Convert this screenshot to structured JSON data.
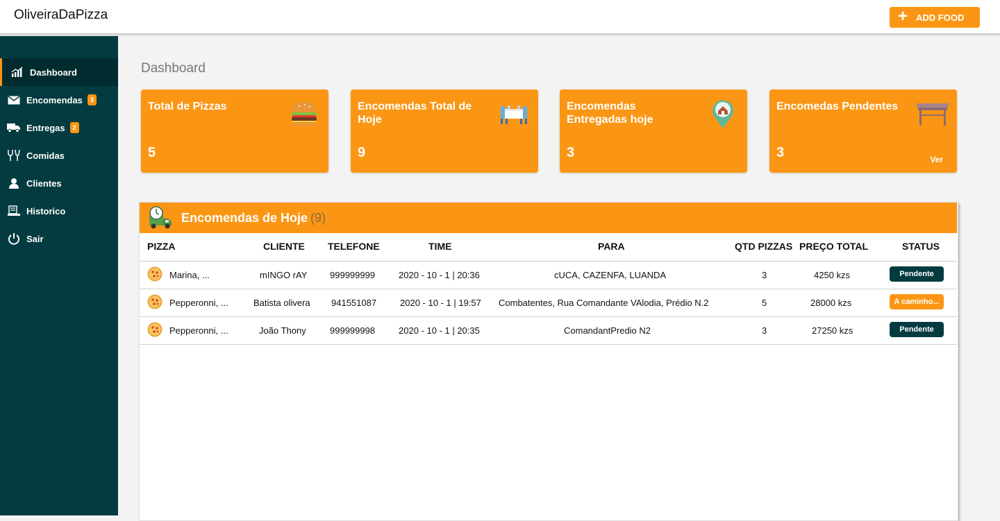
{
  "app": {
    "brand": "OliveiraDaPizza",
    "add_food_label": "ADD FOOD"
  },
  "colors": {
    "accent": "#fb9614",
    "sidebar": "#033b40",
    "sidebar_active": "#022b2f"
  },
  "sidebar": {
    "items": [
      {
        "label": "Dashboard",
        "icon": "chart-icon",
        "active": true
      },
      {
        "label": "Encomendas",
        "icon": "envelope-icon",
        "badge": "3"
      },
      {
        "label": "Entregas",
        "icon": "truck-icon",
        "badge": "2"
      },
      {
        "label": "Comidas",
        "icon": "utensils-icon"
      },
      {
        "label": "Clientes",
        "icon": "user-icon"
      },
      {
        "label": "Historico",
        "icon": "history-icon"
      },
      {
        "label": "Sair",
        "icon": "power-icon"
      }
    ]
  },
  "page": {
    "title": "Dashboard"
  },
  "cards": [
    {
      "title": "Total de Pizzas",
      "value": "5",
      "icon": "burger-icon"
    },
    {
      "title": "Encomendas Total de Hoje",
      "value": "9",
      "icon": "dining-table-icon"
    },
    {
      "title": "Encomendas Entregadas hoje",
      "value": "3",
      "icon": "location-pin-icon"
    },
    {
      "title": "Encomedas Pendentes",
      "value": "3",
      "icon": "table-icon",
      "link": "Ver"
    }
  ],
  "orders": {
    "title": "Encomendas de Hoje",
    "count": "(9)",
    "columns": [
      "PIZZA",
      "CLIENTE",
      "TELEFONE",
      "TIME",
      "PARA",
      "QTD PIZZAS",
      "PREÇO TOTAL",
      "STATUS"
    ],
    "rows": [
      {
        "pizza": "Marina, ...",
        "cliente": "mINGO rAY",
        "telefone": "999999999",
        "time": "2020 - 10 - 1 | 20:36",
        "para": "cUCA, CAZENFA, LUANDA",
        "qtd": "3",
        "preco": "4250 kzs",
        "status": "Pendente"
      },
      {
        "pizza": "Pepperonni, ...",
        "cliente": "Batista olivera",
        "telefone": "941551087",
        "time": "2020 - 10 - 1 | 19:57",
        "para": "Combatentes, Rua Comandante VAlodia, Prédio N.2",
        "qtd": "5",
        "preco": "28000 kzs",
        "status": "A caminho..."
      },
      {
        "pizza": "Pepperonni, ...",
        "cliente": "João Thony",
        "telefone": "999999998",
        "time": "2020 - 10 - 1 | 20:35",
        "para": "ComandantPredio N2",
        "qtd": "3",
        "preco": "27250 kzs",
        "status": "Pendente"
      }
    ]
  }
}
